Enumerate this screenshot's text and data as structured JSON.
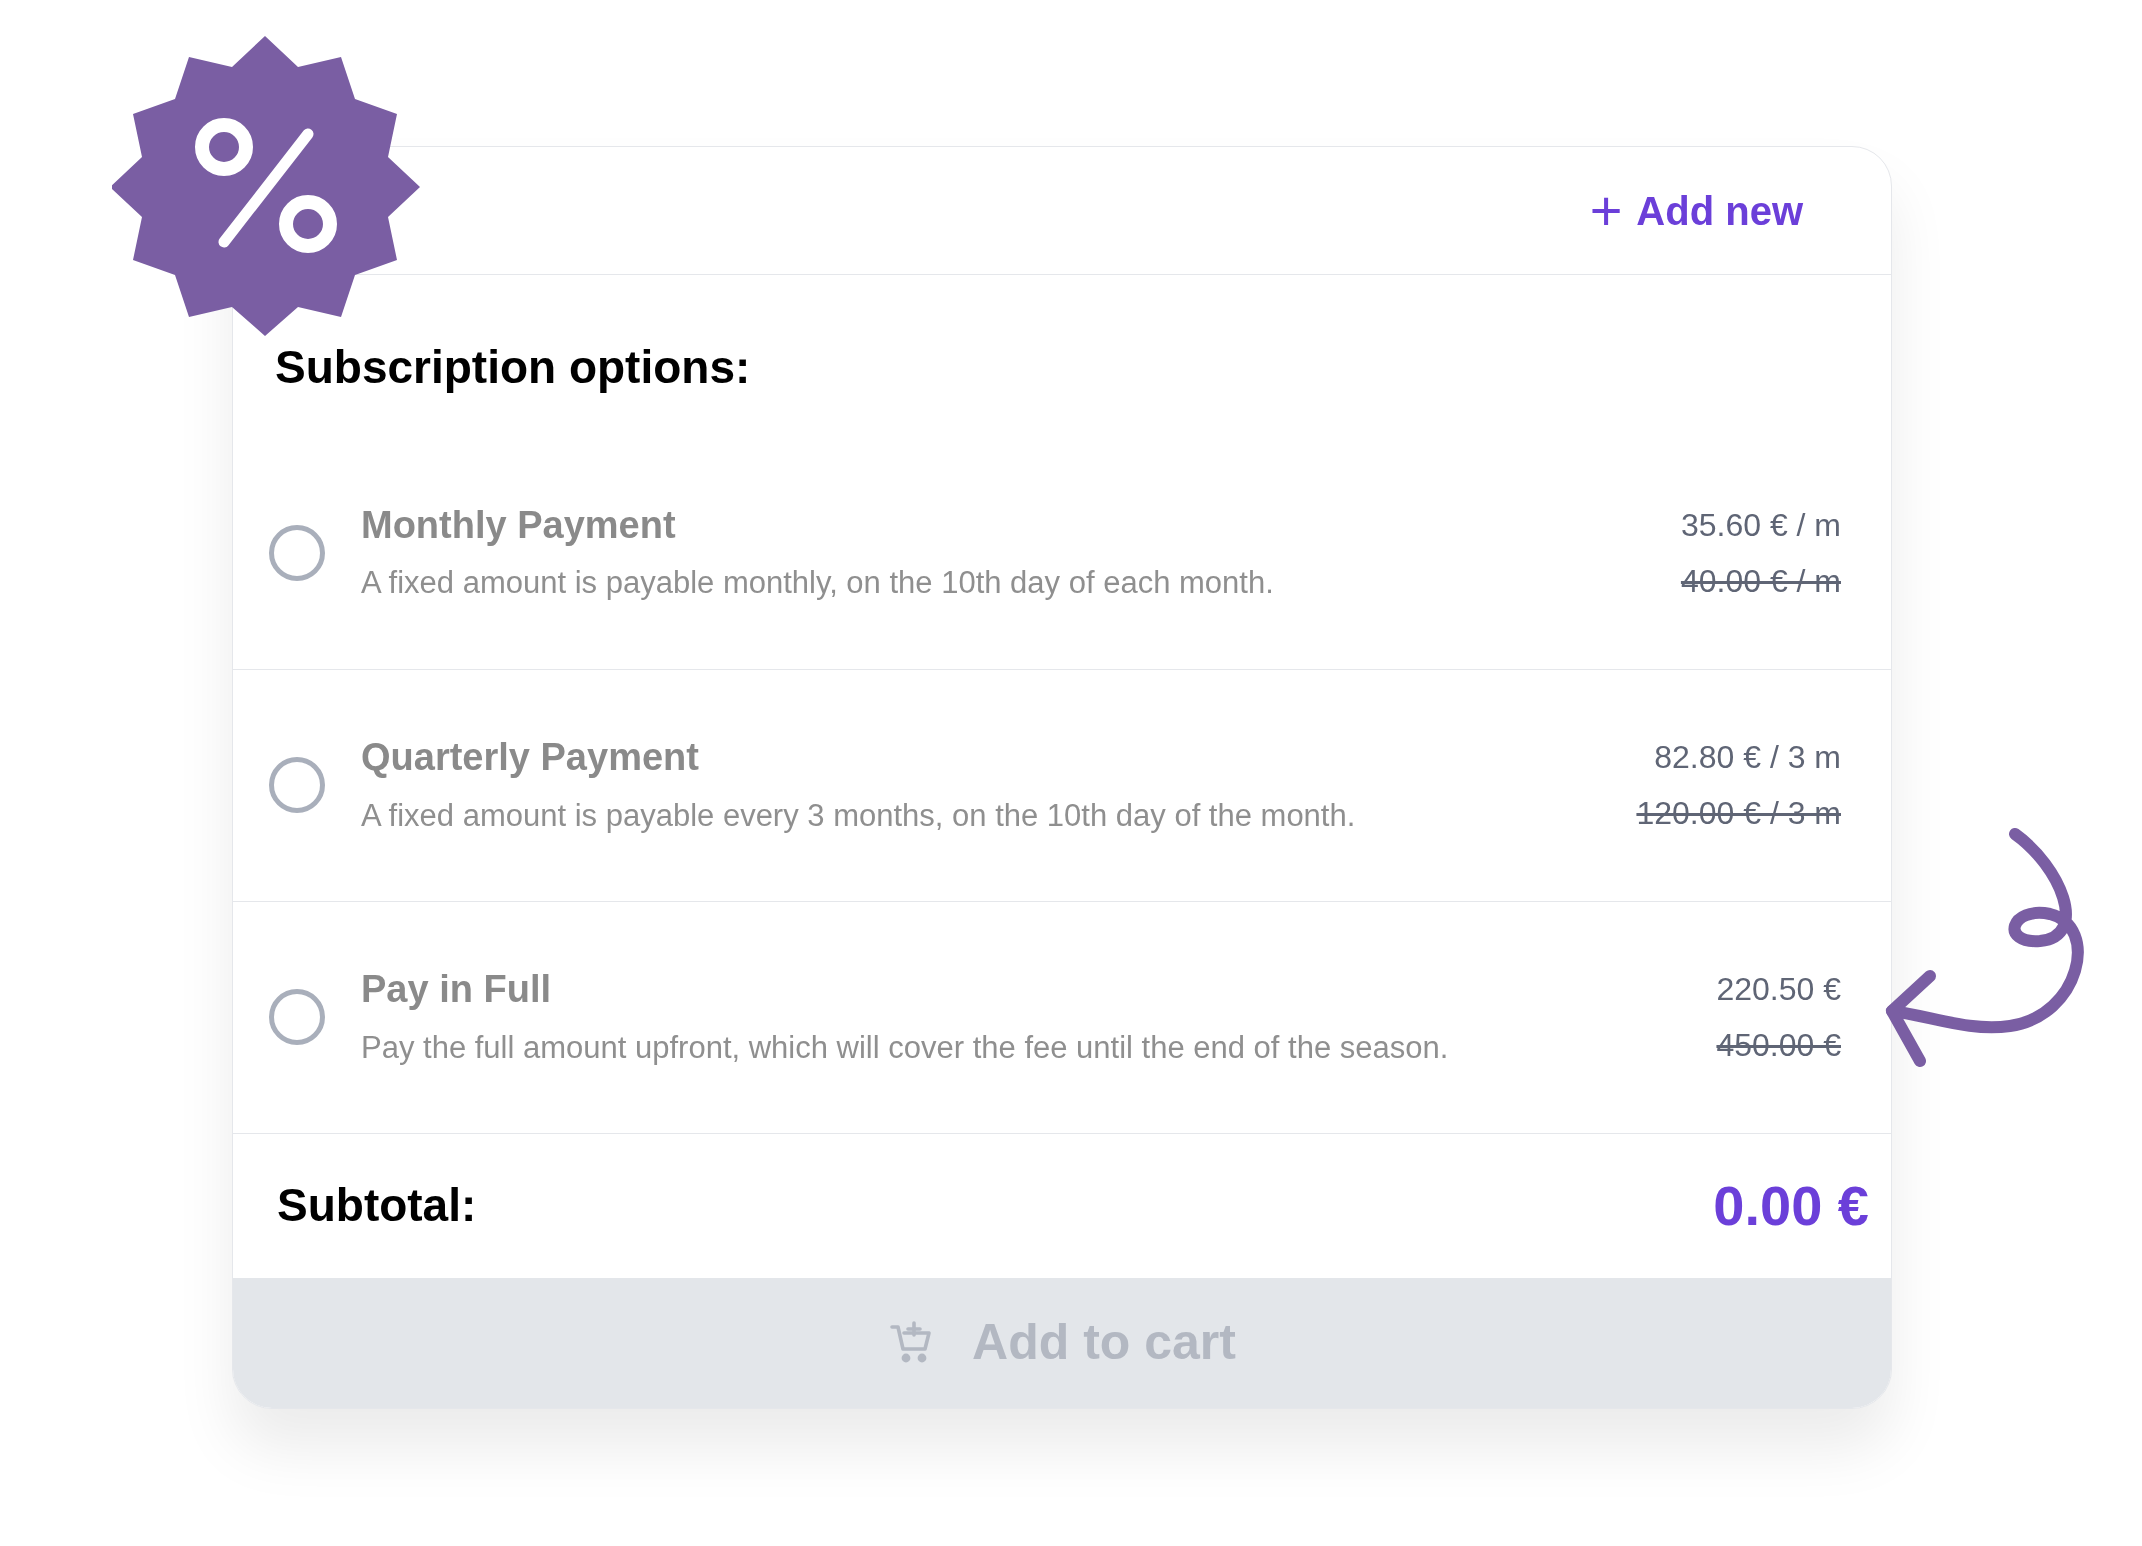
{
  "header": {
    "add_button": {
      "icon": "+",
      "label": "Add new"
    }
  },
  "section_title": "Subscription options:",
  "options": [
    {
      "title": "Monthly Payment",
      "description": "A fixed amount is payable monthly, on the 10th day of each month.",
      "price": "35.60 € / m",
      "old_price": "40.00 € / m",
      "selected": false
    },
    {
      "title": "Quarterly Payment",
      "description": "A fixed amount is payable every 3 months, on the 10th day of the month.",
      "price": "82.80 € / 3 m",
      "old_price": "120.00 € / 3 m",
      "selected": false
    },
    {
      "title": "Pay in Full",
      "description": "Pay the full amount upfront, which will cover the fee until the end of the season.",
      "price": "220.50 €",
      "old_price": "450.00 €",
      "selected": false
    }
  ],
  "subtotal": {
    "label": "Subtotal:",
    "value": "0.00 €"
  },
  "cart_button": {
    "label": "Add to cart",
    "disabled": true
  }
}
